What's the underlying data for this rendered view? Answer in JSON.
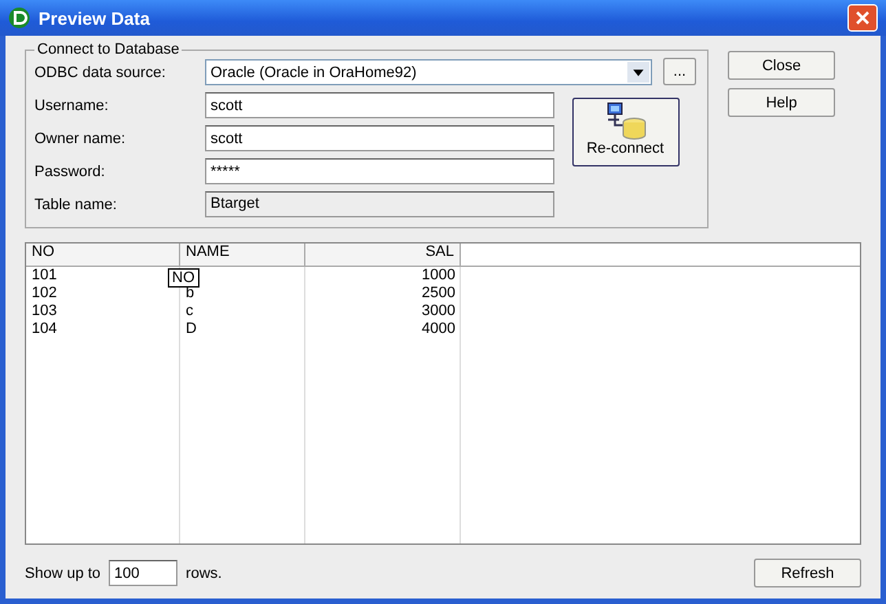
{
  "window": {
    "title": "Preview Data"
  },
  "connection": {
    "group_title": "Connect to Database",
    "fields": [
      {
        "label": "ODBC data source:",
        "value": "Oracle (Oracle in OraHome92)",
        "kind": "dropdown",
        "browse": "..."
      },
      {
        "label": "Username:",
        "value": "scott",
        "kind": "text"
      },
      {
        "label": "Owner name:",
        "value": "scott",
        "kind": "text"
      },
      {
        "label": "Password:",
        "value": "*****",
        "kind": "text"
      },
      {
        "label": "Table name:",
        "value": "Btarget",
        "kind": "readonly"
      }
    ],
    "reconnect_button": "Re-connect"
  },
  "side_buttons": [
    "Close",
    "Help"
  ],
  "table": {
    "columns": [
      {
        "label": "NO"
      },
      {
        "label": "NAME"
      },
      {
        "label": "SAL"
      }
    ],
    "rows": [
      {
        "cells": [
          "101",
          null,
          "1000"
        ]
      },
      {
        "cells": [
          "102",
          "b",
          "2500"
        ]
      },
      {
        "cells": [
          "103",
          "c",
          "3000"
        ]
      },
      {
        "cells": [
          "104",
          "D",
          "4000"
        ]
      }
    ],
    "tooltip": "NO"
  },
  "footer": {
    "prefix": "Show up to",
    "value": "100",
    "suffix": "rows.",
    "button": "Refresh"
  }
}
